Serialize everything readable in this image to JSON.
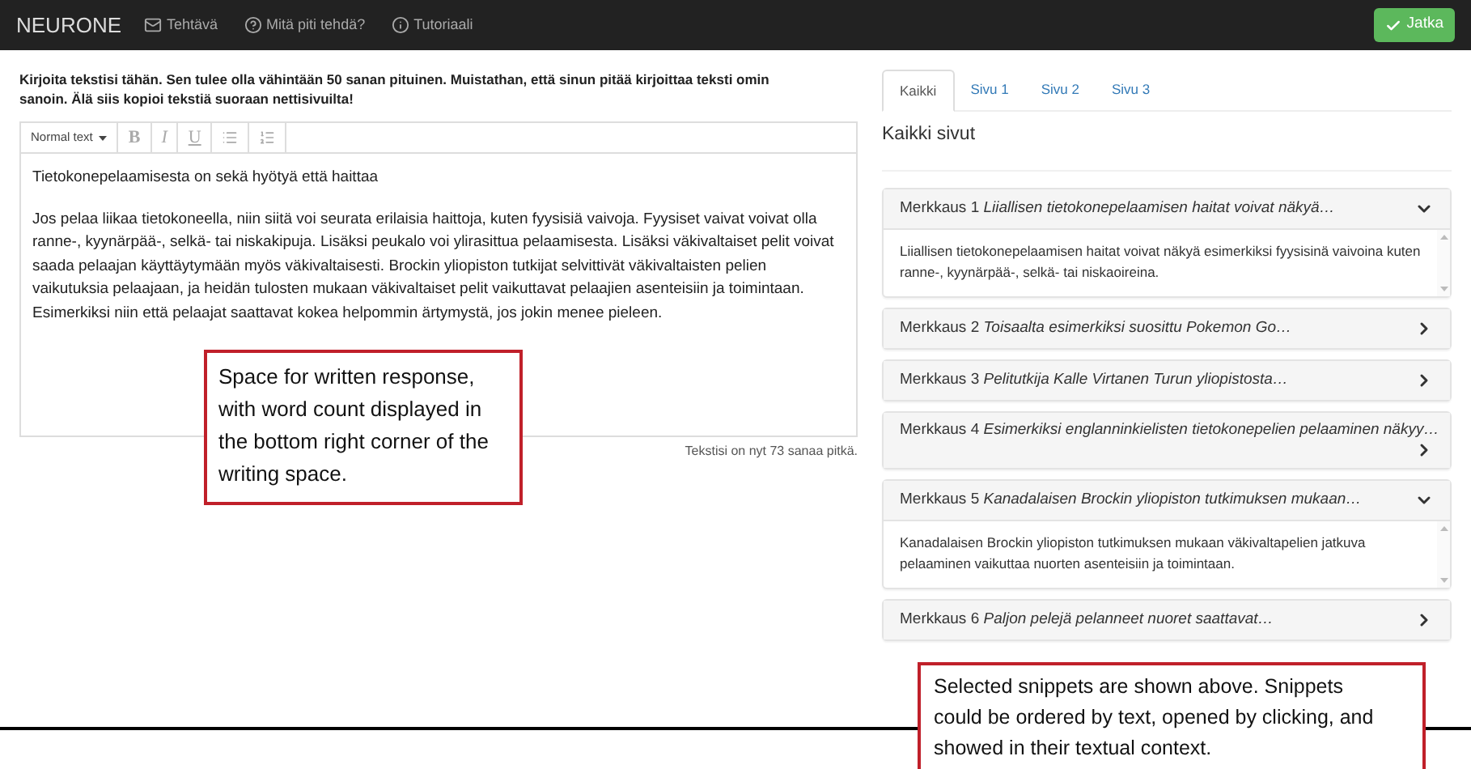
{
  "navbar": {
    "brand": "NEURONE",
    "items": [
      {
        "kind": "mail",
        "label": "Tehtävä"
      },
      {
        "kind": "help",
        "label": "Mitä piti tehdä?"
      },
      {
        "kind": "info",
        "label": "Tutoriaali"
      }
    ],
    "action": "Jatka"
  },
  "instructions": "Kirjoita tekstisi tähän. Sen tulee olla vähintään 50 sanan pituinen. Muistathan, että sinun pitää kirjoittaa teksti omin sanoin. Älä siis kopioi tekstiä suoraan nettisivuilta!",
  "toolbar": {
    "style_select": "Normal text",
    "buttons": [
      {
        "kind": "bold",
        "label": "B"
      },
      {
        "kind": "italic",
        "label": "I"
      },
      {
        "kind": "underline",
        "label": "U"
      },
      {
        "kind": "bullets"
      },
      {
        "kind": "numbers"
      }
    ]
  },
  "editor": {
    "paragraphs": [
      "Tietokonepelaamisesta on sekä hyötyä että haittaa",
      "Jos pelaa liikaa tietokoneella, niin siitä voi seurata erilaisia haittoja, kuten fyysisiä vaivoja. Fyysiset vaivat voivat olla ranne-, kyynärpää-, selkä- tai niskakipuja. Lisäksi peukalo voi ylirasittua pelaamisesta. Lisäksi väkivaltaiset pelit voivat saada pelaajan käyttäytymään myös väkivaltaisesti. Brockin yliopiston tutkijat selvittivät väkivaltaisten pelien vaikutuksia pelaajaan, ja heidän tulosten mukaan väkivaltaiset pelit vaikuttavat pelaajien asenteisiin ja toimintaan. Esimerkiksi niin että pelaajat saattavat kokea helpommin ärtymystä, jos jokin menee pieleen."
    ]
  },
  "word_count": "Tekstisi on nyt 73 sanaa pitkä.",
  "tabs": [
    {
      "label": "Kaikki",
      "selected": true
    },
    {
      "label": "Sivu 1",
      "selected": false
    },
    {
      "label": "Sivu 2",
      "selected": false
    },
    {
      "label": "Sivu 3",
      "selected": false
    }
  ],
  "panel_title": "Kaikki sivut",
  "snippets": [
    {
      "label": "Merkkaus 1",
      "excerpt": "Liiallisen tietokonepelaamisen haitat voivat näkyä…",
      "expanded": true,
      "body": "Liiallisen tietokonepelaamisen haitat voivat näkyä esimerkiksi fyysisinä vaivoina kuten ranne-, kyynärpää-, selkä- tai niskaoireina."
    },
    {
      "label": "Merkkaus 2",
      "excerpt": "Toisaalta esimerkiksi suosittu Pokemon Go…",
      "expanded": false
    },
    {
      "label": "Merkkaus 3",
      "excerpt": "Pelitutkija Kalle Virtanen Turun yliopistosta…",
      "expanded": false
    },
    {
      "label": "Merkkaus 4",
      "excerpt": "Esimerkiksi englanninkielisten tietokonepelien pelaaminen näkyy…",
      "expanded": false
    },
    {
      "label": "Merkkaus 5",
      "excerpt": "Kanadalaisen Brockin yliopiston tutkimuksen mukaan…",
      "expanded": true,
      "body": "Kanadalaisen Brockin yliopiston tutkimuksen mukaan väkivaltapelien jatkuva pelaaminen vaikuttaa nuorten asenteisiin ja toimintaan."
    },
    {
      "label": "Merkkaus 6",
      "excerpt": "Paljon pelejä pelanneet nuoret saattavat…",
      "expanded": false
    }
  ],
  "annotations": [
    {
      "kind": "editor",
      "text": "Space for written response, with word count displayed in the bottom right corner of the writing space."
    },
    {
      "kind": "snippets",
      "text": "Selected snippets are shown above. Snippets could be ordered by text, opened by clicking, and showed in their textual context."
    }
  ]
}
